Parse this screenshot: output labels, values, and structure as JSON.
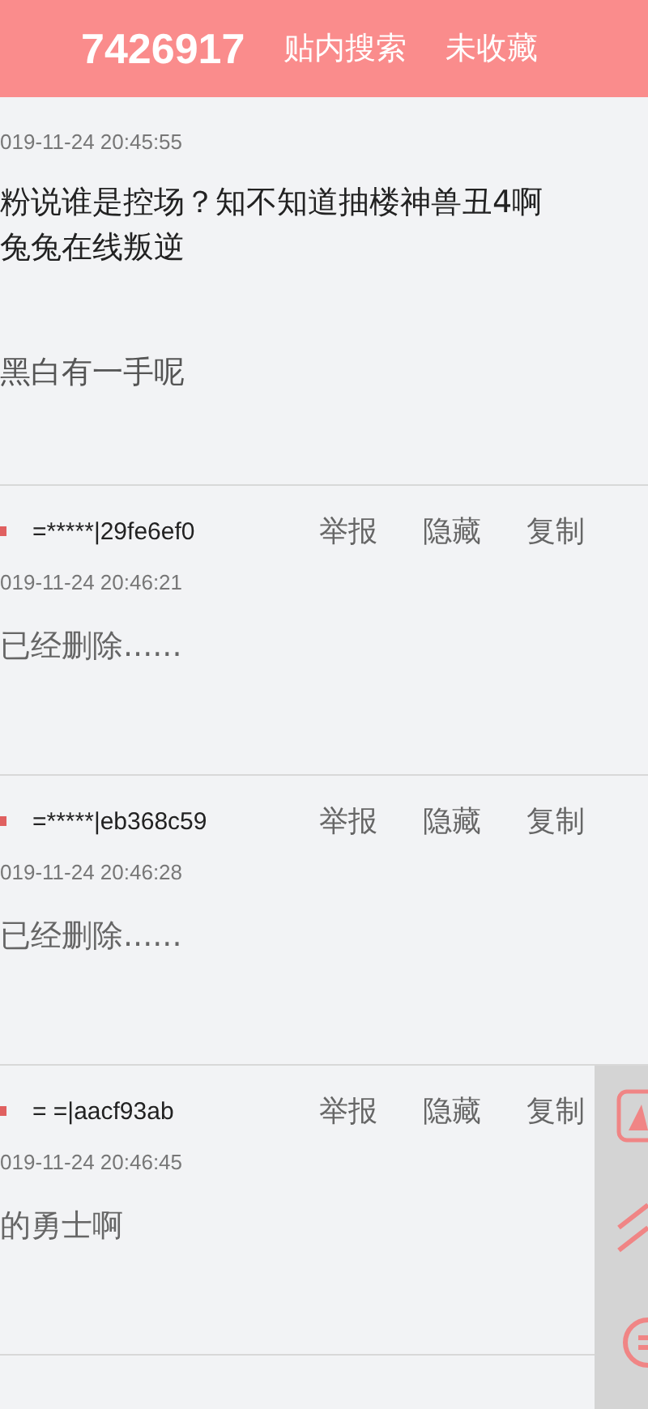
{
  "header": {
    "title": "7426917",
    "actions": [
      "贴内搜索",
      "未收藏"
    ]
  },
  "posts": [
    {
      "time": "019-11-24 20:45:55",
      "lines": [
        "粉说谁是控场？知不知道抽楼神兽丑4啊",
        "兔兔在线叛逆"
      ],
      "quote": "黑白有一手呢"
    },
    {
      "user": "=*****|29fe6ef0",
      "actions": [
        "举报",
        "隐藏",
        "复制"
      ],
      "time": "019-11-24 20:46:21",
      "lines": [
        "已经删除......"
      ]
    },
    {
      "user": "=*****|eb368c59",
      "actions": [
        "举报",
        "隐藏",
        "复制"
      ],
      "time": "019-11-24 20:46:28",
      "lines": [
        "已经删除......"
      ]
    },
    {
      "user": "= =|aacf93ab",
      "actions": [
        "举报",
        "隐藏",
        "复制"
      ],
      "time": "019-11-24 20:46:45",
      "lines": [
        "的勇士啊"
      ]
    }
  ]
}
